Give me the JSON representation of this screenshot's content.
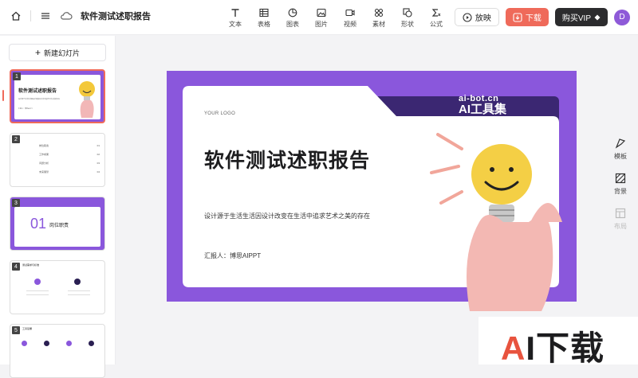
{
  "header": {
    "doc_title": "软件测试述职报告",
    "tools": [
      {
        "label": "文本",
        "icon": "text-icon"
      },
      {
        "label": "表格",
        "icon": "table-icon"
      },
      {
        "label": "图表",
        "icon": "chart-icon"
      },
      {
        "label": "图片",
        "icon": "image-icon"
      },
      {
        "label": "视频",
        "icon": "video-icon"
      },
      {
        "label": "素材",
        "icon": "material-icon"
      },
      {
        "label": "形状",
        "icon": "shape-icon"
      },
      {
        "label": "公式",
        "icon": "formula-icon"
      }
    ],
    "play_label": "放映",
    "download_label": "下载",
    "vip_label": "购买VIP",
    "avatar_letter": "D"
  },
  "sidebar": {
    "new_slide_label": "新建幻灯片",
    "slides": [
      {
        "num": "1",
        "title": "软件测试述职报告",
        "sub": "设计源于生活生活因设计改变在生活中追求艺术之美的存在",
        "reporter": "汇报人：博思AIPPT"
      },
      {
        "num": "2",
        "items": [
          {
            "label": "岗位职责",
            "page": "01"
          },
          {
            "label": "工作成果",
            "page": "02"
          },
          {
            "label": "问题分析",
            "page": "03"
          },
          {
            "label": "未来展望",
            "page": "04"
          }
        ]
      },
      {
        "num": "3",
        "big": "01",
        "title": "岗位职责"
      },
      {
        "num": "4",
        "title": "测试需求与标准"
      },
      {
        "num": "5",
        "title": "工具掌握"
      }
    ]
  },
  "slide": {
    "logo": "YOUR LOGO",
    "title": "软件测试述职报告",
    "subtitle": "设计源于生活生活因设计改变在生活中追求艺术之美的存在",
    "reporter": "汇报人：博思AIPPT",
    "watermark_top": "ai-bot.cn",
    "watermark_bottom": "AI工具集"
  },
  "right_panel": {
    "items": [
      {
        "label": "模板",
        "icon": "template-icon"
      },
      {
        "label": "背景",
        "icon": "background-icon"
      },
      {
        "label": "布局",
        "icon": "layout-icon"
      }
    ]
  },
  "badge": {
    "text_a": "A",
    "text_rest": "I下载"
  },
  "colors": {
    "accent": "#8a57dc",
    "primary_btn": "#ef6a5a",
    "dark_tab": "#3b2772"
  }
}
